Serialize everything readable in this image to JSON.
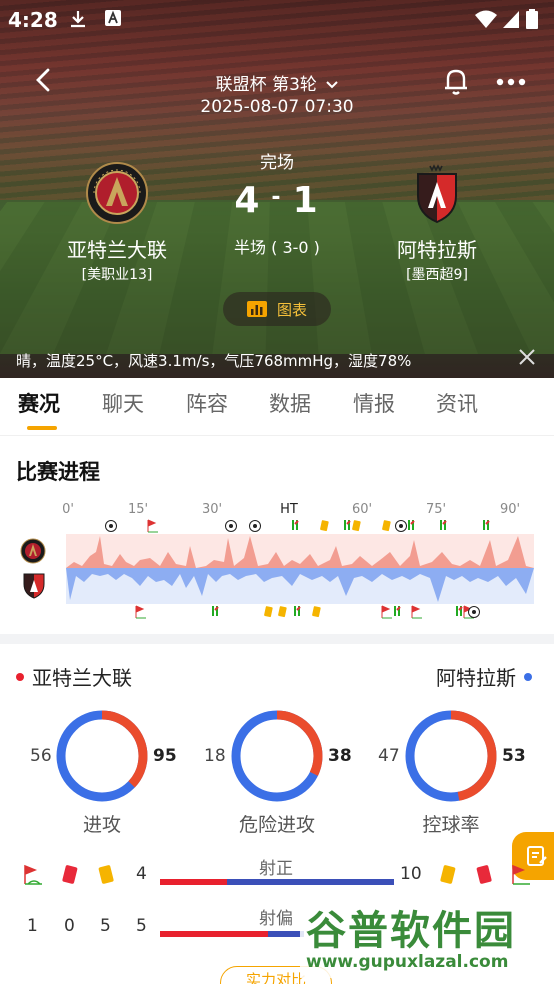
{
  "status_bar": {
    "time": "4:28"
  },
  "header": {
    "title": "联盟杯 第3轮",
    "datetime": "2025-08-07 07:30"
  },
  "match": {
    "state": "完场",
    "home_score": "4",
    "away_score": "1",
    "score_sep": "-",
    "halftime": "半场 ( 3-0 )",
    "home": {
      "name": "亚特兰大联",
      "league": "[美职业13]"
    },
    "away": {
      "name": "阿特拉斯",
      "league": "[墨西超9]"
    },
    "chart_button": "图表",
    "weather": "晴，温度25°C，风速3.1m/s，气压768mmHg，湿度78%"
  },
  "tabs": [
    {
      "label": "赛况"
    },
    {
      "label": "聊天"
    },
    {
      "label": "阵容"
    },
    {
      "label": "数据"
    },
    {
      "label": "情报"
    },
    {
      "label": "资讯"
    }
  ],
  "progress": {
    "title": "比赛进程",
    "ticks": [
      "0'",
      "15'",
      "30'",
      "HT",
      "60'",
      "75'",
      "90'"
    ]
  },
  "stats": {
    "home_name": "亚特兰大联",
    "away_name": "阿特拉斯",
    "home_color": "#e8212e",
    "away_color": "#3b6fe6",
    "rings": [
      {
        "label": "进攻",
        "home": "56",
        "away": "95",
        "home_val": 56,
        "away_val": 95
      },
      {
        "label": "危险进攻",
        "home": "18",
        "away": "38",
        "home_val": 18,
        "away_val": 38
      },
      {
        "label": "控球率",
        "home": "47",
        "away": "53",
        "home_val": 47,
        "away_val": 53
      }
    ],
    "shots_on": {
      "label": "射正",
      "home_corners": "4",
      "away_corners": "10",
      "home_val": 4,
      "away_val": 10
    },
    "shots_off": {
      "label": "射偏",
      "home_row": [
        "1",
        "0",
        "5",
        "5"
      ]
    },
    "compare_button": "实力对比"
  },
  "watermark": {
    "big": "谷普软件园",
    "small": "www.gupuxlazal.com"
  }
}
